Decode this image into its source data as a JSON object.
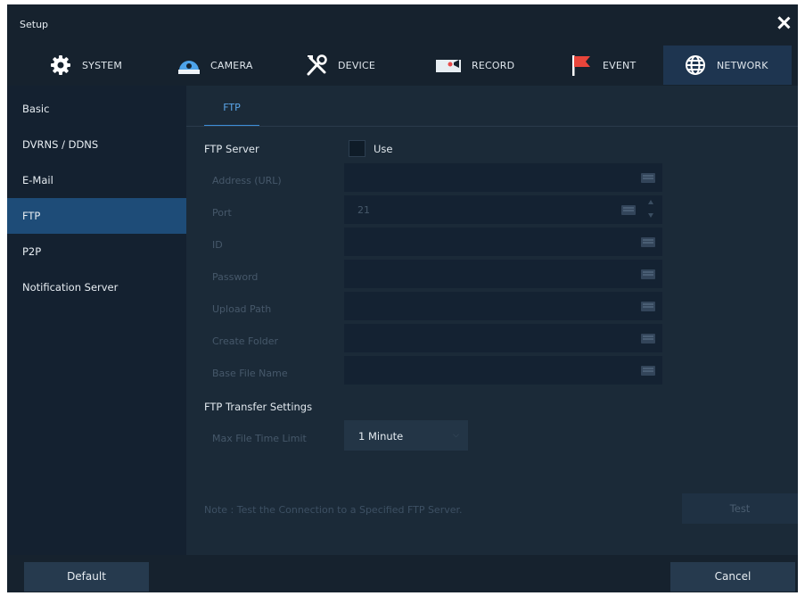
{
  "window": {
    "title": "Setup"
  },
  "tabs": [
    {
      "label": "SYSTEM",
      "icon": "gear-icon"
    },
    {
      "label": "CAMERA",
      "icon": "camera-icon"
    },
    {
      "label": "DEVICE",
      "icon": "tools-icon"
    },
    {
      "label": "RECORD",
      "icon": "record-icon"
    },
    {
      "label": "EVENT",
      "icon": "flag-icon"
    },
    {
      "label": "NETWORK",
      "icon": "globe-icon",
      "active": true
    }
  ],
  "sidebar": {
    "items": [
      {
        "label": "Basic"
      },
      {
        "label": "DVRNS / DDNS"
      },
      {
        "label": "E-Mail"
      },
      {
        "label": "FTP",
        "active": true
      },
      {
        "label": "P2P"
      },
      {
        "label": "Notification Server"
      }
    ]
  },
  "content": {
    "subtab": "FTP",
    "ftp_server_label": "FTP Server",
    "use_label": "Use",
    "use_checked": false,
    "fields": [
      {
        "label": "Address (URL)",
        "value": ""
      },
      {
        "label": "Port",
        "value": "21"
      },
      {
        "label": "ID",
        "value": ""
      },
      {
        "label": "Password",
        "value": ""
      },
      {
        "label": "Upload Path",
        "value": ""
      },
      {
        "label": "Create Folder",
        "value": ""
      },
      {
        "label": "Base File Name",
        "value": ""
      }
    ],
    "transfer_label": "FTP Transfer Settings",
    "max_file_time_label": "Max File Time Limit",
    "max_file_time_value": "1 Minute",
    "note": "Note : Test the Connection to a Specified FTP Server.",
    "test_button": "Test"
  },
  "footer": {
    "default_button": "Default",
    "cancel_button": "Cancel"
  },
  "colors": {
    "accent": "#3d8fd9",
    "active_sidebar": "#1e4c78",
    "active_tab": "#1e3550",
    "background": "#1b2a38"
  }
}
